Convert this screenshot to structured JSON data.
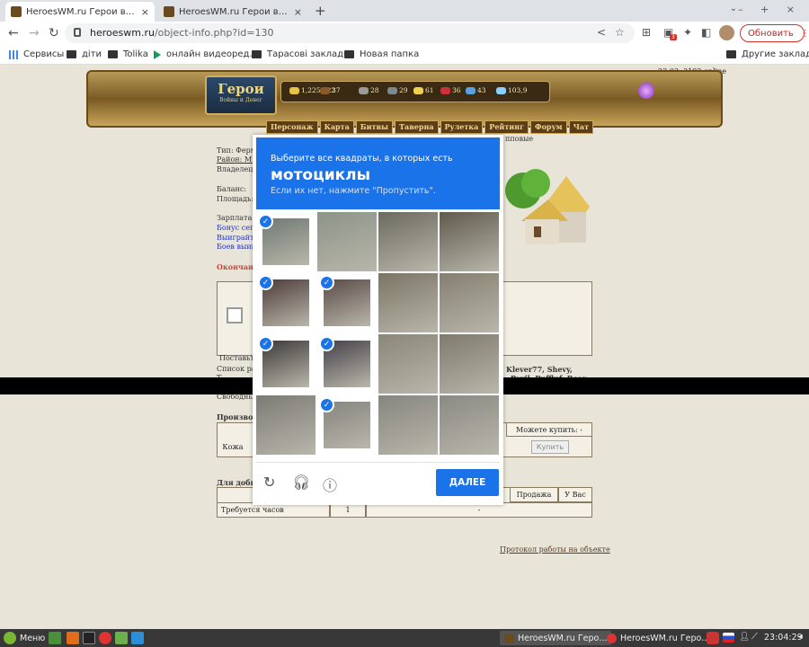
{
  "browser": {
    "tabs": [
      {
        "title": "HeroesWM.ru Герои войны и ..."
      },
      {
        "title": "HeroesWM.ru Герои войны и ..."
      }
    ],
    "new_tab": "+",
    "close": "×",
    "window_controls": "– + ×",
    "url": {
      "host": "heroeswm.ru",
      "path": "/object-info.php?id=130"
    },
    "update_button": "Обновить",
    "extension_badge": "3",
    "bookmarks": [
      {
        "label": "Сервисы",
        "icon": "apps-grid-icon"
      },
      {
        "label": "діти",
        "icon": "folder-icon"
      },
      {
        "label": "Tolika",
        "icon": "folder-icon"
      },
      {
        "label": "онлайн видеоред...",
        "icon": "play-icon"
      },
      {
        "label": "Тарасові закладки",
        "icon": "folder-icon"
      },
      {
        "label": "Новая папка",
        "icon": "folder-icon"
      }
    ],
    "other_bookmarks": "Другие закладки"
  },
  "game": {
    "online": "23:03, 3192 online",
    "logo": {
      "title": "Герои",
      "subtitle": "Войны и Денег"
    },
    "resources": [
      {
        "value": "1,225,622",
        "color": "#e8c34a"
      },
      {
        "value": "37",
        "color": "#8b5a2b"
      },
      {
        "value": "28",
        "color": "#9a9a9a"
      },
      {
        "value": "29",
        "color": "#7a8a90"
      },
      {
        "value": "61",
        "color": "#f0d050"
      },
      {
        "value": "36",
        "color": "#d0303a"
      },
      {
        "value": "43",
        "color": "#5aa0e0"
      },
      {
        "value": "103,9",
        "color": "#8ad0ff"
      }
    ],
    "menu": [
      "Персонаж",
      "Карта",
      "Битвы",
      "Таверна",
      "Рулетка",
      "Рейтинг",
      "Форум",
      "Чат"
    ],
    "info_lines": {
      "type": "Тип: Ферм",
      "district": "Район: Mi",
      "owner": "Владелец:",
      "balance": "Баланс:",
      "area": "Площадь:",
      "salary": "Зарплата:",
      "bonus": "Бонус сего",
      "win": "Выиграйте",
      "battles": "Боев выиг",
      "end": "Окончани",
      "groups_suffix": "пповые"
    },
    "post_label": "Поставьте",
    "list_label": "Список ра",
    "list_names": "Klever77, Shevy,",
    "list_names2": "Pavil, Puffluf, Roar",
    "list_prefix2": "Т...",
    "free_label": "Свободны",
    "produced_label": "Производ",
    "can_buy": "Можете купить: -",
    "item_leather": "Кожа",
    "buy_button": "Купить",
    "for_mining": "Для добы",
    "sell": "Продажа",
    "you_have": "У Вас",
    "hours_required": "Требуется часов",
    "hours_value": "1",
    "dash": "-",
    "protocol_link": "Протокол работы на объекте"
  },
  "captcha": {
    "instruction": "Выберите все квадраты, в которых есть",
    "target": "мотоциклы",
    "hint": "Если их нет, нажмите \"Пропустить\".",
    "next_button": "ДАЛЕЕ",
    "tiles": [
      {
        "selected": true,
        "color": "#6f7a74"
      },
      {
        "selected": false,
        "color": "#8c9488"
      },
      {
        "selected": false,
        "color": "#6c6a60"
      },
      {
        "selected": false,
        "color": "#5f5a4c"
      },
      {
        "selected": true,
        "color": "#4d3c3a"
      },
      {
        "selected": true,
        "color": "#5a4b47"
      },
      {
        "selected": false,
        "color": "#7a7565"
      },
      {
        "selected": false,
        "color": "#847f70"
      },
      {
        "selected": true,
        "color": "#3e3a3a"
      },
      {
        "selected": true,
        "color": "#45414a"
      },
      {
        "selected": false,
        "color": "#8a8678"
      },
      {
        "selected": false,
        "color": "#7e7a6c"
      },
      {
        "selected": false,
        "color": "#7b7b76"
      },
      {
        "selected": true,
        "color": "#85857f"
      },
      {
        "selected": false,
        "color": "#86867f"
      },
      {
        "selected": false,
        "color": "#8a8a84"
      }
    ]
  },
  "taskbar": {
    "menu": "Меню",
    "windows": [
      "HeroesWM.ru Геро...",
      "HeroesWM.ru Геро..."
    ],
    "clock": "23:04:29"
  }
}
